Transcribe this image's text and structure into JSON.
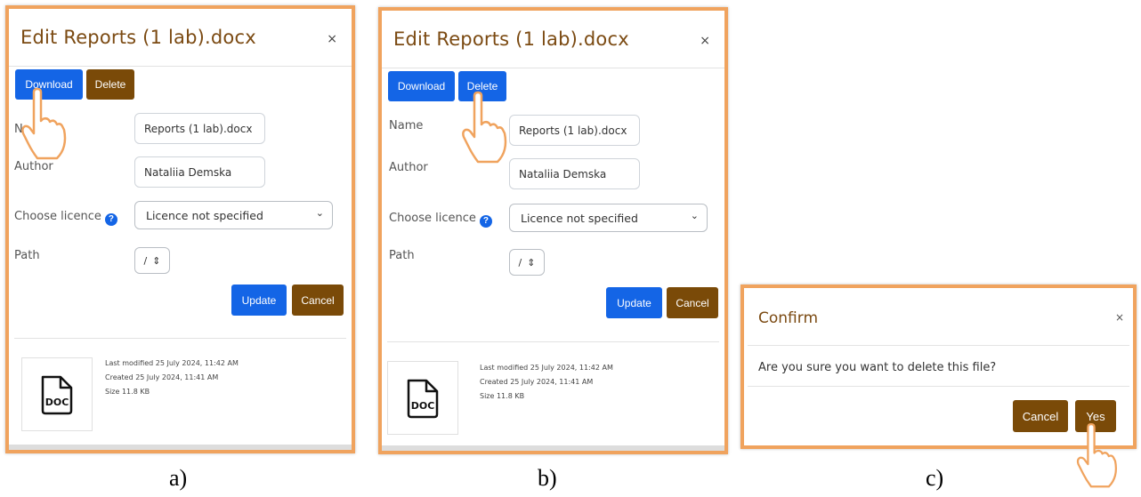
{
  "panel_a": {
    "title": "Edit Reports (1 lab).docx",
    "close": "×",
    "download_label": "Download",
    "delete_label": "Delete",
    "name_label": "N",
    "name_value": "Reports (1 lab).docx",
    "author_label": "Author",
    "author_value": "Nataliia Demska",
    "licence_label": "Choose licence",
    "licence_value": "Licence not specified",
    "path_label": "Path",
    "path_value": "/",
    "update_label": "Update",
    "cancel_label": "Cancel",
    "last_modified": "Last modified  25 July 2024, 11:42 AM",
    "created": "Created  25 July 2024, 11:41 AM",
    "size": "Size  11.8 KB",
    "doc_label": "DOC",
    "caption": "a)"
  },
  "panel_b": {
    "title": "Edit Reports (1 lab).docx",
    "close": "×",
    "download_label": "Download",
    "delete_label": "Delete",
    "name_label": "Name",
    "name_value": "Reports (1 lab).docx",
    "author_label": "Author",
    "author_value": "Nataliia Demska",
    "licence_label": "Choose licence",
    "licence_value": "Licence not specified",
    "path_label": "Path",
    "path_value": "/",
    "update_label": "Update",
    "cancel_label": "Cancel",
    "last_modified": "Last modified  25 July 2024, 11:42 AM",
    "created": "Created  25 July 2024, 11:41 AM",
    "size": "Size  11.8 KB",
    "doc_label": "DOC",
    "caption": "b)"
  },
  "panel_c": {
    "title": "Confirm",
    "close": "×",
    "message": "Are you sure you want to delete this file?",
    "cancel_label": "Cancel",
    "yes_label": "Yes",
    "caption": "c)"
  },
  "colors": {
    "accent_blue": "#1465e6",
    "accent_brown": "#7a4a08",
    "title_brown": "#7b4a12",
    "frame_orange": "#f0a35e"
  },
  "icons": [
    "pointing-hand-icon",
    "doc-file-icon",
    "help-icon",
    "chevron-down-icon",
    "close-icon"
  ]
}
